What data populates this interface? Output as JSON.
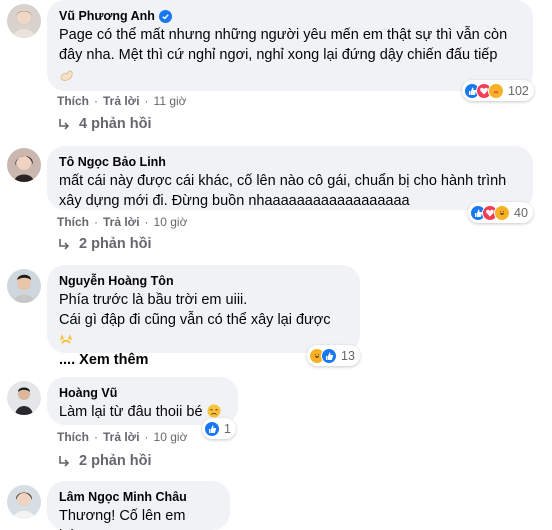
{
  "comments": [
    {
      "author": "Vũ Phương Anh",
      "verified": true,
      "text": "Page có thể mất nhưng những người yêu mến em thật sự thì vẫn còn đây nha. Mệt thì cứ nghỉ ngơi, nghỉ xong lại đứng dậy chiến đấu tiếp",
      "reactions": [
        "like",
        "love",
        "care"
      ],
      "reaction_count": "102",
      "like_label": "Thích",
      "reply_label": "Trả lời",
      "time": "11 giờ",
      "replies_label": "4 phản hồi"
    },
    {
      "author": "Tô Ngọc Bảo Linh",
      "text": "mất cái này được cái khác, cố lên nào cô gái, chuẩn bị cho hành trình xây dựng mới đi. Đừng buồn nhaaaaaaaaaaaaaaaaaa",
      "reactions": [
        "like",
        "love",
        "haha"
      ],
      "reaction_count": "40",
      "like_label": "Thích",
      "reply_label": "Trả lời",
      "time": "10 giờ",
      "replies_label": "2 phản hồi"
    },
    {
      "author": "Nguyễn Hoàng Tôn",
      "text": "Phía trước là bầu trời em uiii.\nCái gì đập đi cũng vẫn có thể xây lại được",
      "see_more": ".... Xem thêm",
      "reactions": [
        "haha",
        "like"
      ],
      "reaction_count": "13"
    },
    {
      "author": "Hoàng Vũ",
      "text": "Làm lại từ đâu thoii bé",
      "reactions": [
        "like"
      ],
      "reaction_count": "1",
      "like_label": "Thích",
      "reply_label": "Trả lời",
      "time": "10 giờ",
      "replies_label": "2 phản hồi"
    },
    {
      "author": "Lâm Ngọc Minh Châu",
      "text": "Thương! Cố lên em bé!..."
    }
  ],
  "colors": {
    "bubble": "#f0f2f5",
    "meta": "#65676b",
    "like": "#1877f2",
    "love": "#f33e58",
    "haha": "#f7b125"
  }
}
